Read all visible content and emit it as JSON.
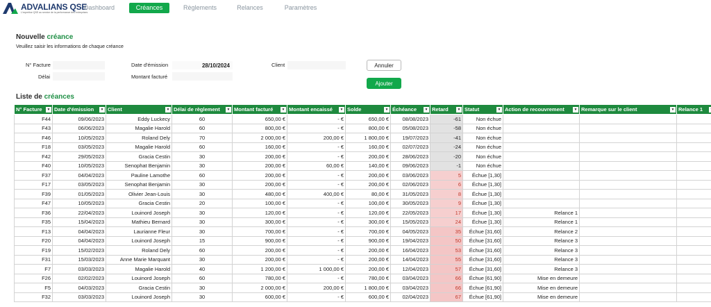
{
  "brand": {
    "name": "ADVALIANS QSE",
    "tagline": "L'expertise QSE au service de la performance des entreprises"
  },
  "nav": [
    {
      "label": "Dashboard",
      "active": false
    },
    {
      "label": "Créances",
      "active": true
    },
    {
      "label": "Règlements",
      "active": false
    },
    {
      "label": "Relances",
      "active": false
    },
    {
      "label": "Paramètres",
      "active": false
    }
  ],
  "form": {
    "title_prefix": "Nouvelle ",
    "title_accent": "créance",
    "subtitle": "Veuillez saisir les informations de chaque créance",
    "labels": {
      "facture": "N° Facture",
      "delai": "Délai",
      "date_emission": "Date d'émission",
      "montant_facture": "Montant facturé",
      "client": "Client"
    },
    "values": {
      "facture": "",
      "delai": "",
      "date_emission": "28/10/2024",
      "montant_facture": "",
      "client": ""
    },
    "annuler": "Annuler",
    "ajouter": "Ajouter"
  },
  "list": {
    "title_prefix": "Liste de ",
    "title_accent": "créances",
    "columns": [
      "N° Facture",
      "Date d'émission",
      "Client",
      "Délai de règlement",
      "Montant facturé",
      "Montant encaissé",
      "Solde",
      "Échéance",
      "Retard",
      "Statut",
      "Action de recouvrement",
      "Remarque sur le client",
      "Relance 1"
    ],
    "rows": [
      [
        "F44",
        "09/06/2023",
        "Eddy Luckecy",
        "60",
        "650,00 €",
        "-   €",
        "650,00 €",
        "08/08/2023",
        "-61",
        "Non échue",
        "",
        ""
      ],
      [
        "F43",
        "06/06/2023",
        "Magalie Harold",
        "60",
        "800,00 €",
        "-   €",
        "800,00 €",
        "05/08/2023",
        "-58",
        "Non échue",
        "",
        ""
      ],
      [
        "F46",
        "10/05/2023",
        "Roland Dely",
        "70",
        "2 000,00 €",
        "200,00 €",
        "1 800,00 €",
        "19/07/2023",
        "-41",
        "Non échue",
        "",
        ""
      ],
      [
        "F18",
        "03/05/2023",
        "Magalie Harold",
        "60",
        "160,00 €",
        "-   €",
        "160,00 €",
        "02/07/2023",
        "-24",
        "Non échue",
        "",
        ""
      ],
      [
        "F42",
        "29/05/2023",
        "Gracia Cestin",
        "30",
        "200,00 €",
        "-   €",
        "200,00 €",
        "28/06/2023",
        "-20",
        "Non échue",
        "",
        ""
      ],
      [
        "F40",
        "10/05/2023",
        "Senophat Benjamin",
        "30",
        "200,00 €",
        "60,00 €",
        "140,00 €",
        "09/06/2023",
        "-1",
        "Non échue",
        "",
        ""
      ],
      [
        "F37",
        "04/04/2023",
        "Pauline Lamothe",
        "60",
        "200,00 €",
        "-   €",
        "200,00 €",
        "03/06/2023",
        "5",
        "Échue [1,30]",
        "",
        ""
      ],
      [
        "F17",
        "03/05/2023",
        "Senophat Benjamin",
        "30",
        "200,00 €",
        "-   €",
        "200,00 €",
        "02/06/2023",
        "6",
        "Échue [1,30]",
        "",
        ""
      ],
      [
        "F39",
        "01/05/2023",
        "Olivier Jean-Louis",
        "30",
        "480,00 €",
        "400,00 €",
        "80,00 €",
        "31/05/2023",
        "8",
        "Échue [1,30]",
        "",
        ""
      ],
      [
        "F47",
        "10/05/2023",
        "Gracia Cestin",
        "20",
        "100,00 €",
        "-   €",
        "100,00 €",
        "30/05/2023",
        "9",
        "Échue [1,30]",
        "",
        ""
      ],
      [
        "F36",
        "22/04/2023",
        "Louinord Joseph",
        "30",
        "120,00 €",
        "-   €",
        "120,00 €",
        "22/05/2023",
        "17",
        "Échue [1,30]",
        "Relance 1",
        ""
      ],
      [
        "F35",
        "15/04/2023",
        "Mathieu Bernard",
        "30",
        "300,00 €",
        "-   €",
        "300,00 €",
        "15/05/2023",
        "24",
        "Échue [1,30]",
        "Relance 1",
        ""
      ],
      [
        "F13",
        "04/04/2023",
        "Laurianne Fleur",
        "30",
        "700,00 €",
        "-   €",
        "700,00 €",
        "04/05/2023",
        "35",
        "Échue [31,60]",
        "Relance 2",
        ""
      ],
      [
        "F20",
        "04/04/2023",
        "Louinord Joseph",
        "15",
        "900,00 €",
        "-   €",
        "900,00 €",
        "19/04/2023",
        "50",
        "Échue [31,60]",
        "Relance 3",
        ""
      ],
      [
        "F19",
        "15/02/2023",
        "Roland Dely",
        "60",
        "200,00 €",
        "-   €",
        "200,00 €",
        "16/04/2023",
        "53",
        "Échue [31,60]",
        "Relance 3",
        ""
      ],
      [
        "F31",
        "15/03/2023",
        "Anne Marie Marquant",
        "30",
        "200,00 €",
        "-   €",
        "200,00 €",
        "14/04/2023",
        "55",
        "Échue [31,60]",
        "Relance 3",
        ""
      ],
      [
        "F7",
        "03/03/2023",
        "Magalie Harold",
        "40",
        "1 200,00 €",
        "1 000,00 €",
        "200,00 €",
        "12/04/2023",
        "57",
        "Échue [31,60]",
        "Relance 3",
        ""
      ],
      [
        "F26",
        "02/02/2023",
        "Louinord Joseph",
        "60",
        "780,00 €",
        "-   €",
        "780,00 €",
        "03/04/2023",
        "66",
        "Échue [61,90]",
        "Mise en demeure",
        ""
      ],
      [
        "F5",
        "04/03/2023",
        "Gracia Cestin",
        "30",
        "2 000,00 €",
        "200,00 €",
        "1 800,00 €",
        "03/04/2023",
        "66",
        "Échue [61,90]",
        "Mise en demeure",
        ""
      ],
      [
        "F32",
        "03/03/2023",
        "Louinord Joseph",
        "30",
        "600,00 €",
        "-   €",
        "600,00 €",
        "02/04/2023",
        "67",
        "Échue [61,90]",
        "Mise en demeure",
        ""
      ]
    ]
  }
}
